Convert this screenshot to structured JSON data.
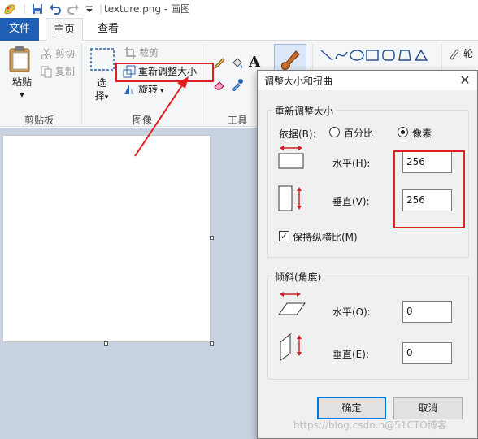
{
  "window": {
    "title": "texture.png - 画图"
  },
  "tabs": [
    {
      "label": "文件"
    },
    {
      "label": "主页"
    },
    {
      "label": "查看"
    }
  ],
  "ribbon": {
    "clipboard": {
      "paste": "粘贴",
      "paste_arrow": "▾",
      "cut": "剪切",
      "copy": "复制",
      "group": "剪贴板"
    },
    "image": {
      "select_line1": "选",
      "select_line2": "择",
      "crop": "裁剪",
      "resize": "重新调整大小",
      "rotate": "旋转",
      "group": "图像"
    },
    "tools": {
      "group": "工具",
      "text_tool": "A"
    },
    "shapes": {
      "outline_partial": "轮"
    }
  },
  "colors": {
    "accent": "#1e5fb4",
    "annotation": "#e02020",
    "workspace": "#c8d2e1",
    "ok_border": "#0078d7"
  },
  "dialog": {
    "title": "调整大小和扭曲",
    "close": "✕",
    "resize": {
      "heading": "重新调整大小",
      "by_label": "依据(B):",
      "option_percent": "百分比",
      "option_pixels": "像素",
      "selected": "像素",
      "horizontal_label": "水平(H):",
      "horizontal_value": "256",
      "vertical_label": "垂直(V):",
      "vertical_value": "256",
      "keep_ratio_label": "保持纵横比(M)",
      "keep_ratio_checked": true,
      "check_mark": "✓"
    },
    "skew": {
      "heading": "倾斜(角度)",
      "horizontal_label": "水平(O):",
      "horizontal_value": "0",
      "vertical_label": "垂直(E):",
      "vertical_value": "0"
    },
    "ok": "确定",
    "cancel": "取消"
  },
  "watermark": "https://blog.csdn.n@51CTO博客"
}
